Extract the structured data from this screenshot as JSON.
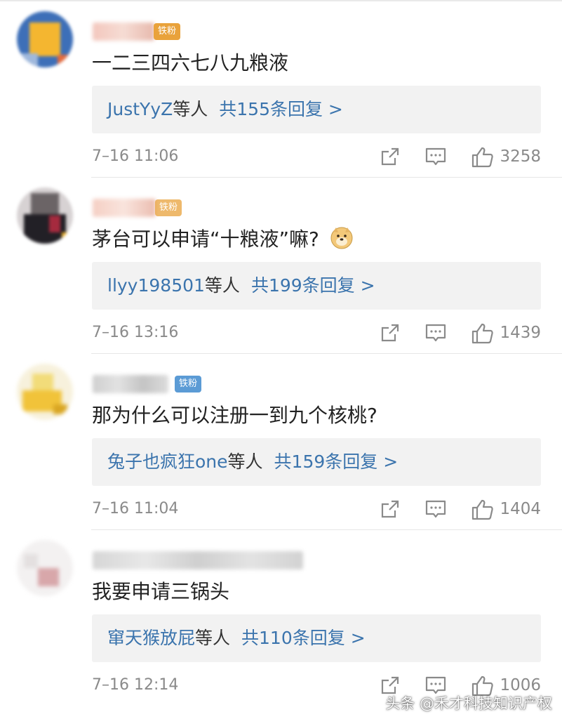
{
  "comments": [
    {
      "badge": "铁粉",
      "text": "一二三四六七八九粮液",
      "reply_users": "JustYyZ",
      "reply_suffix": "等人",
      "reply_total": "共155条回复 >",
      "time": "7–16 11:06",
      "likes": "3258"
    },
    {
      "badge": "铁粉",
      "text": "茅台可以申请“十粮液”嘛?",
      "emoji": "doge-emoji",
      "reply_users": "llyy198501",
      "reply_suffix": "等人",
      "reply_total": "共199条回复 >",
      "time": "7–16 13:16",
      "likes": "1439"
    },
    {
      "badge": "铁粉",
      "text": "那为什么可以注册一到九个核桃?",
      "reply_users": "兔子也疯狂one",
      "reply_suffix": "等人",
      "reply_total": "共159条回复 >",
      "time": "7–16 11:04",
      "likes": "1404"
    },
    {
      "text": "我要申请三锅头",
      "reply_users": "窜天猴放屁",
      "reply_suffix": "等人",
      "reply_total": "共110条回复 >",
      "time": "7–16 12:14",
      "likes": "1006"
    }
  ],
  "icons": {
    "share": "share-icon",
    "comment": "comment-icon",
    "like": "thumbs-up-icon"
  },
  "colors": {
    "link": "#3b74ad",
    "badge": "#5b9bd5",
    "meta": "#8a8a8a",
    "reply_bg": "#f2f2f2"
  },
  "watermark": "头条 @禾才科技知识产权"
}
